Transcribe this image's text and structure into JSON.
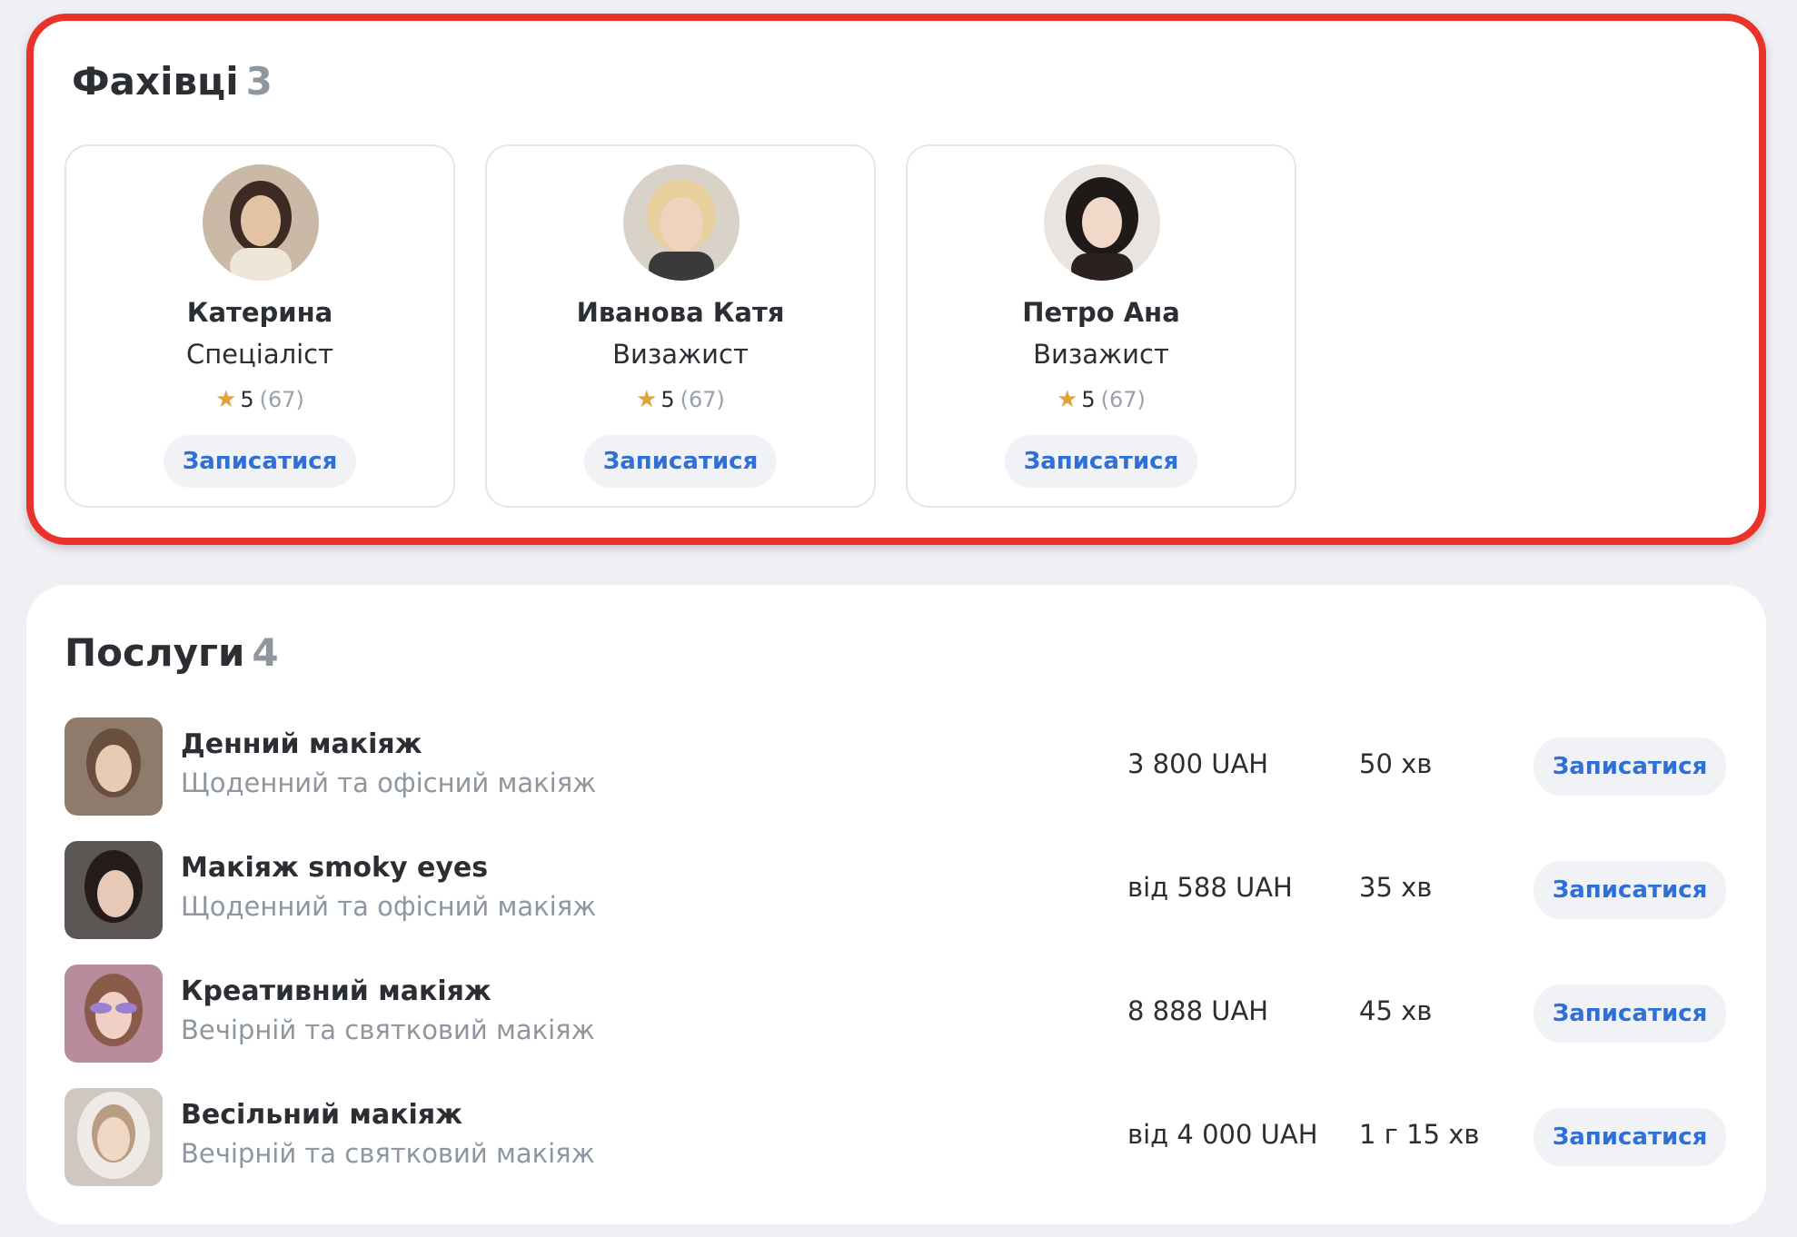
{
  "specialists": {
    "title": "Фахівці",
    "count": "3",
    "items": [
      {
        "name": "Катерина",
        "role": "Спеціаліст",
        "rating": "5",
        "reviews": "(67)",
        "book_label": "Записатися",
        "avatar_color": "#8a6f5c"
      },
      {
        "name": "Иванова Катя",
        "role": "Визажист",
        "rating": "5",
        "reviews": "(67)",
        "book_label": "Записатися",
        "avatar_color": "#d8c3a8"
      },
      {
        "name": "Петро Ана",
        "role": "Визажист",
        "rating": "5",
        "reviews": "(67)",
        "book_label": "Записатися",
        "avatar_color": "#4a3a36"
      }
    ]
  },
  "services": {
    "title": "Послуги",
    "count": "4",
    "items": [
      {
        "name": "Денний макіяж",
        "description": "Щоденний та офісний макіяж",
        "price": "3 800 UAH",
        "duration": "50 хв",
        "book_label": "Записатися",
        "thumb_color": "#b9a08c"
      },
      {
        "name": "Макіяж smoky eyes",
        "description": "Щоденний та офісний макіяж",
        "price": "від 588 UAH",
        "duration": "35 хв",
        "book_label": "Записатися",
        "thumb_color": "#5a4e4a"
      },
      {
        "name": "Креативний макіяж",
        "description": "Вечірній та святковий макіяж",
        "price": "8 888 UAH",
        "duration": "45 хв",
        "book_label": "Записатися",
        "thumb_color": "#c7a1b3"
      },
      {
        "name": "Весільний макіяж",
        "description": "Вечірній та святковий макіяж",
        "price": "від 4 000 UAH",
        "duration": "1 г 15 хв",
        "book_label": "Записатися",
        "thumb_color": "#a99b8f"
      }
    ]
  },
  "colors": {
    "accent": "#2f6fd8",
    "highlight_border": "#e8322a",
    "star": "#e2a13d",
    "muted_text": "#8e979f"
  }
}
